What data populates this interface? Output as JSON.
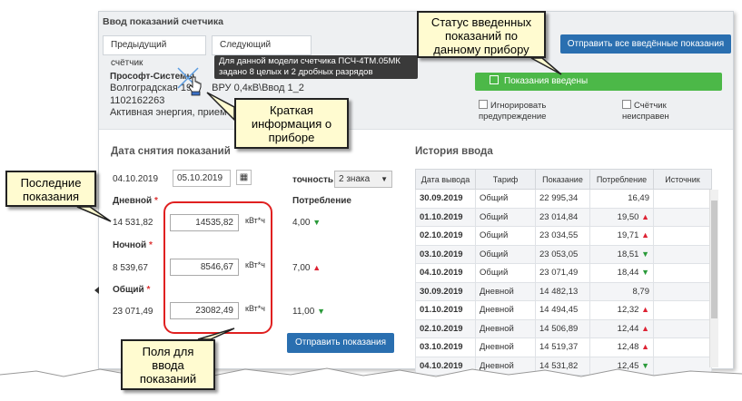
{
  "panel": {
    "title": "Ввод показаний счетчика",
    "tabs": [
      "Предыдущий счётчик",
      "Следующий счётчик"
    ],
    "send_all_label": "Отправить все введённые показания"
  },
  "tooltip": {
    "line1": "Для данной модели счетчика ПСЧ-4ТМ.05МК",
    "line2": "задано 8 целых и 2 дробных разрядов"
  },
  "device": {
    "name": "Прософт-Системы",
    "address_start": "Волгоградская 19",
    "address_end": "ВРУ 0,4кВ\\Ввод 1_2",
    "id": "1102162263",
    "type_text": "Активная энергия, прием"
  },
  "status": {
    "label": "Показания введены",
    "color": "#4cb848"
  },
  "checkboxes": {
    "ignore_line1": "Игнорировать",
    "ignore_line2": "предупреждение",
    "faulty_line1": "Счётчик",
    "faulty_line2": "неисправен"
  },
  "readings": {
    "section_title": "Дата снятия показаний",
    "prev_date": "04.10.2019",
    "curr_date": "05.10.2019",
    "precision_label": "точность:",
    "precision_value": "2 знака",
    "consumption_label": "Потребление",
    "unit": "кВт*ч",
    "send_label": "Отправить показания",
    "rows": [
      {
        "label": "Дневной",
        "prev": "14 531,82",
        "value": "14535,82",
        "consumption": "4,00",
        "trend": "down"
      },
      {
        "label": "Ночной",
        "prev": "8 539,67",
        "value": "8546,67",
        "consumption": "7,00",
        "trend": "up"
      },
      {
        "label": "Общий",
        "prev": "23 071,49",
        "value": "23082,49",
        "consumption": "11,00",
        "trend": "down"
      }
    ]
  },
  "history": {
    "title": "История ввода",
    "columns": [
      "Дата вывода",
      "Тариф",
      "Показание",
      "Потребление",
      "Источник"
    ],
    "rows": [
      {
        "date": "30.09.2019",
        "tariff": "Общий",
        "value": "22 995,34",
        "consumption": "16,49",
        "trend": ""
      },
      {
        "date": "01.10.2019",
        "tariff": "Общий",
        "value": "23 014,84",
        "consumption": "19,50",
        "trend": "up"
      },
      {
        "date": "02.10.2019",
        "tariff": "Общий",
        "value": "23 034,55",
        "consumption": "19,71",
        "trend": "up"
      },
      {
        "date": "03.10.2019",
        "tariff": "Общий",
        "value": "23 053,05",
        "consumption": "18,51",
        "trend": "down"
      },
      {
        "date": "04.10.2019",
        "tariff": "Общий",
        "value": "23 071,49",
        "consumption": "18,44",
        "trend": "down"
      },
      {
        "date": "30.09.2019",
        "tariff": "Дневной",
        "value": "14 482,13",
        "consumption": "8,79",
        "trend": ""
      },
      {
        "date": "01.10.2019",
        "tariff": "Дневной",
        "value": "14 494,45",
        "consumption": "12,32",
        "trend": "up"
      },
      {
        "date": "02.10.2019",
        "tariff": "Дневной",
        "value": "14 506,89",
        "consumption": "12,44",
        "trend": "up"
      },
      {
        "date": "03.10.2019",
        "tariff": "Дневной",
        "value": "14 519,37",
        "consumption": "12,48",
        "trend": "up"
      },
      {
        "date": "04.10.2019",
        "tariff": "Дневной",
        "value": "14 531,82",
        "consumption": "12,45",
        "trend": "down"
      }
    ]
  },
  "callouts": {
    "status": [
      "Статус введенных",
      "показаний по",
      "данному прибору"
    ],
    "info": [
      "Краткая",
      "информация о",
      "приборе"
    ],
    "last": [
      "Последние",
      "показания"
    ],
    "fields": [
      "Поля для",
      "ввода",
      "показаний"
    ]
  },
  "colors": {
    "accent": "#2a6fb0",
    "status_ok": "#4cb848",
    "trend_up": "#d23",
    "trend_down": "#2a9a3a",
    "highlight": "#e02020",
    "callout_bg": "#fffbd0"
  }
}
